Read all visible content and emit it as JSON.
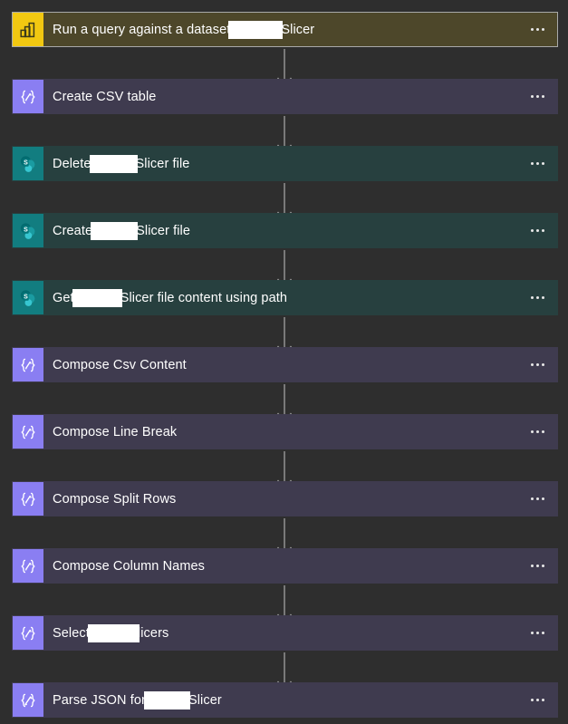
{
  "canvas": {
    "background": "#2e2e2e",
    "connector_color": "#9a9a9a",
    "menu_label": "···",
    "menu_aria": "More commands"
  },
  "palette": {
    "powerbi_yellow": "#f2c811",
    "compose_purple": "#8a7ef2",
    "sharepoint_teal": "#127d80",
    "card_purple_bg": "#3f3b4f",
    "card_teal_bg": "#27403f",
    "card_olive_bg": "#4d472a",
    "selected_border": "#a9a9a9",
    "text_white": "#ffffff",
    "redaction_white": "#ffffff"
  },
  "steps": [
    {
      "id": "run-query-against-dataset",
      "icon": "power-bi-icon",
      "icon_style": "powerbi",
      "card_style": "olive",
      "selected": true,
      "title_before": "Run a query against a dataset",
      "redaction_width": 60,
      "title_after": "Slicer",
      "menu": "···"
    },
    {
      "id": "create-csv-table",
      "icon": "compose-icon",
      "icon_style": "compose",
      "card_style": "purple",
      "selected": false,
      "title_before": "Create CSV table",
      "redaction_width": 0,
      "title_after": "",
      "menu": "···"
    },
    {
      "id": "delete-slicer-file",
      "icon": "sharepoint-icon",
      "icon_style": "sharepoint",
      "card_style": "teal",
      "selected": false,
      "title_before": "Delete ",
      "redaction_width": 53,
      "title_after": "Slicer file",
      "menu": "···"
    },
    {
      "id": "create-slicer-file",
      "icon": "sharepoint-icon",
      "icon_style": "sharepoint",
      "card_style": "teal",
      "selected": false,
      "title_before": "Create ",
      "redaction_width": 52,
      "title_after": "Slicer file",
      "menu": "···"
    },
    {
      "id": "get-slicer-file-content-using-path",
      "icon": "sharepoint-icon",
      "icon_style": "sharepoint",
      "card_style": "teal",
      "selected": false,
      "title_before": "Get ",
      "redaction_width": 55,
      "title_after": "Slicer file content using path",
      "menu": "···"
    },
    {
      "id": "compose-csv-content",
      "icon": "compose-icon",
      "icon_style": "compose",
      "card_style": "purple",
      "selected": false,
      "title_before": "Compose Csv Content",
      "redaction_width": 0,
      "title_after": "",
      "menu": "···"
    },
    {
      "id": "compose-line-break",
      "icon": "compose-icon",
      "icon_style": "compose",
      "card_style": "purple",
      "selected": false,
      "title_before": "Compose Line Break",
      "redaction_width": 0,
      "title_after": "",
      "menu": "···"
    },
    {
      "id": "compose-split-rows",
      "icon": "compose-icon",
      "icon_style": "compose",
      "card_style": "purple",
      "selected": false,
      "title_before": "Compose Split Rows",
      "redaction_width": 0,
      "title_after": "",
      "menu": "···"
    },
    {
      "id": "compose-column-names",
      "icon": "compose-icon",
      "icon_style": "compose",
      "card_style": "purple",
      "selected": false,
      "title_before": "Compose Column Names",
      "redaction_width": 0,
      "title_after": "",
      "menu": "···"
    },
    {
      "id": "select-slicers",
      "icon": "compose-icon",
      "icon_style": "compose",
      "card_style": "purple",
      "selected": false,
      "title_before": "Select ",
      "redaction_width": 57,
      "title_after": "licers",
      "menu": "···"
    },
    {
      "id": "parse-json-for-slicer",
      "icon": "parse-json-icon",
      "icon_style": "compose",
      "card_style": "purple",
      "selected": false,
      "title_before": "Parse JSON for ",
      "redaction_width": 51,
      "title_after": "Slicer",
      "menu": "···"
    }
  ]
}
